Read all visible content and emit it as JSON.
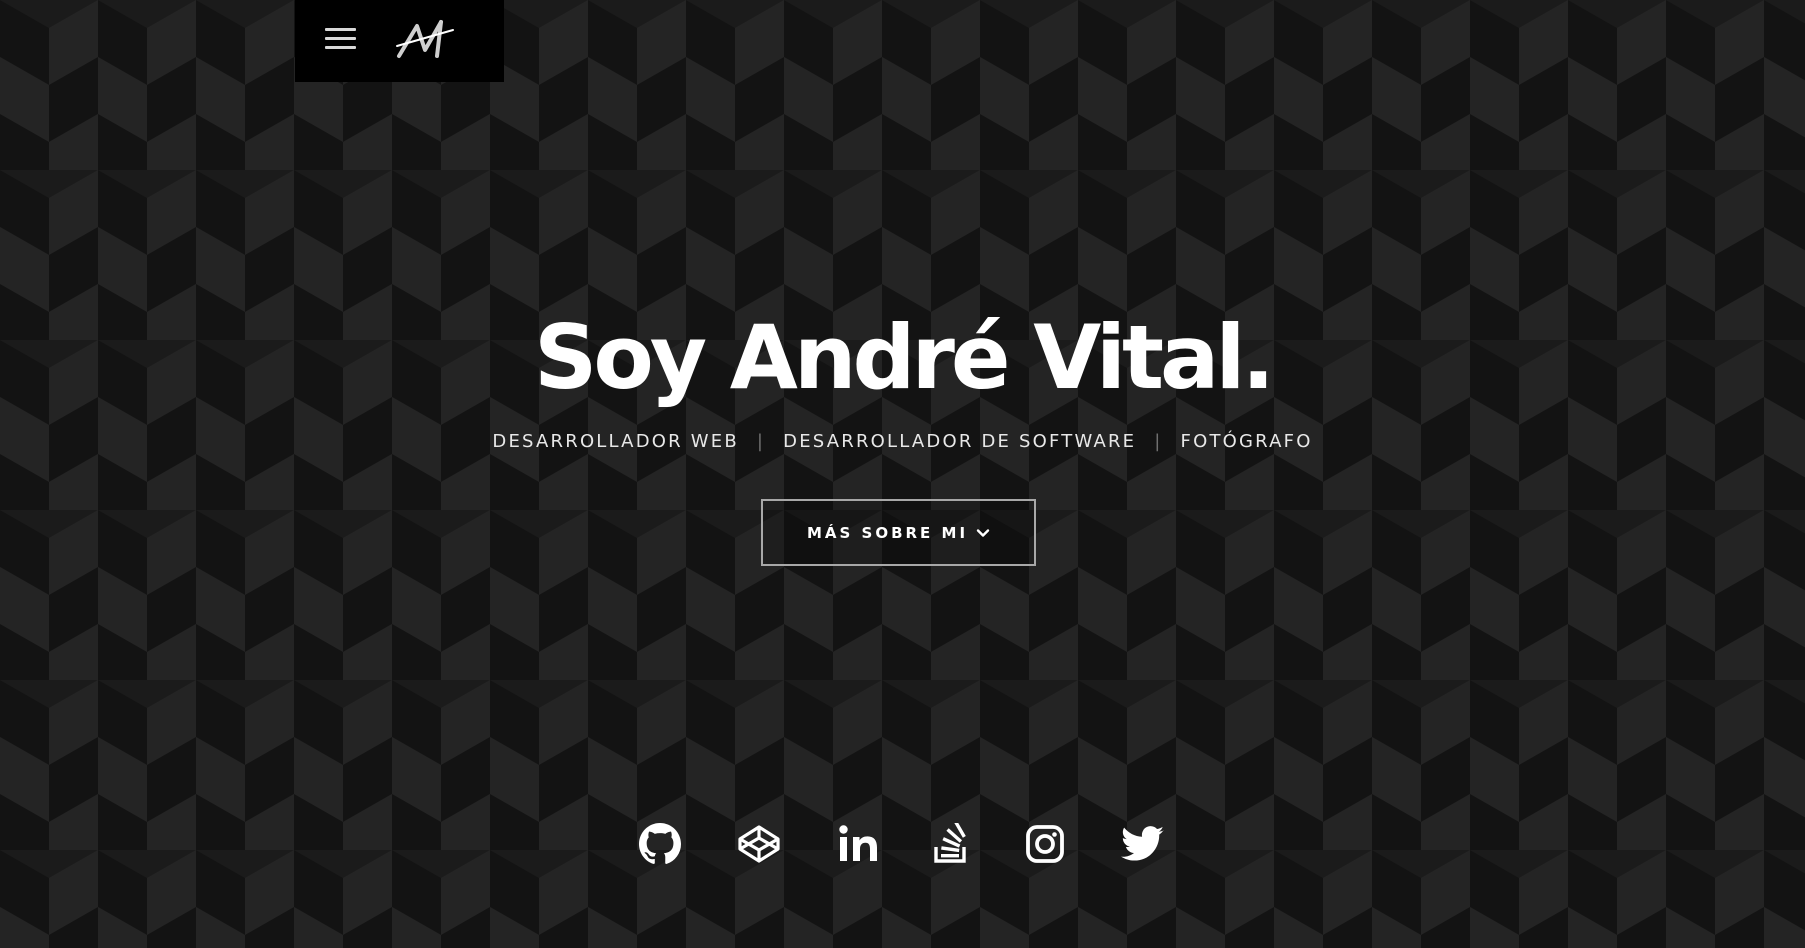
{
  "header": {
    "menu_icon": "hamburger-menu-icon",
    "logo_icon": "av-monogram-logo"
  },
  "hero": {
    "title": "Soy André Vital.",
    "roles": [
      "DESARROLLADOR WEB",
      "DESARROLLADOR DE SOFTWARE",
      "FOTÓGRAFO"
    ],
    "separator": "|",
    "cta_label": "MÁS SOBRE MI",
    "cta_icon": "chevron-down-icon"
  },
  "social_links": [
    {
      "name": "GitHub",
      "icon": "github-icon"
    },
    {
      "name": "CodePen",
      "icon": "codepen-icon"
    },
    {
      "name": "LinkedIn",
      "icon": "linkedin-icon"
    },
    {
      "name": "Stack Overflow",
      "icon": "stackoverflow-icon"
    },
    {
      "name": "Instagram",
      "icon": "instagram-icon"
    },
    {
      "name": "Twitter",
      "icon": "twitter-icon"
    }
  ],
  "colors": {
    "background": "#1e1e1e",
    "cube_dark": "#131313",
    "cube_mid": "#1b1b1b",
    "cube_light": "#242424",
    "text": "#ffffff",
    "topbar": "#000000",
    "button_border": "#a8a8a8"
  }
}
